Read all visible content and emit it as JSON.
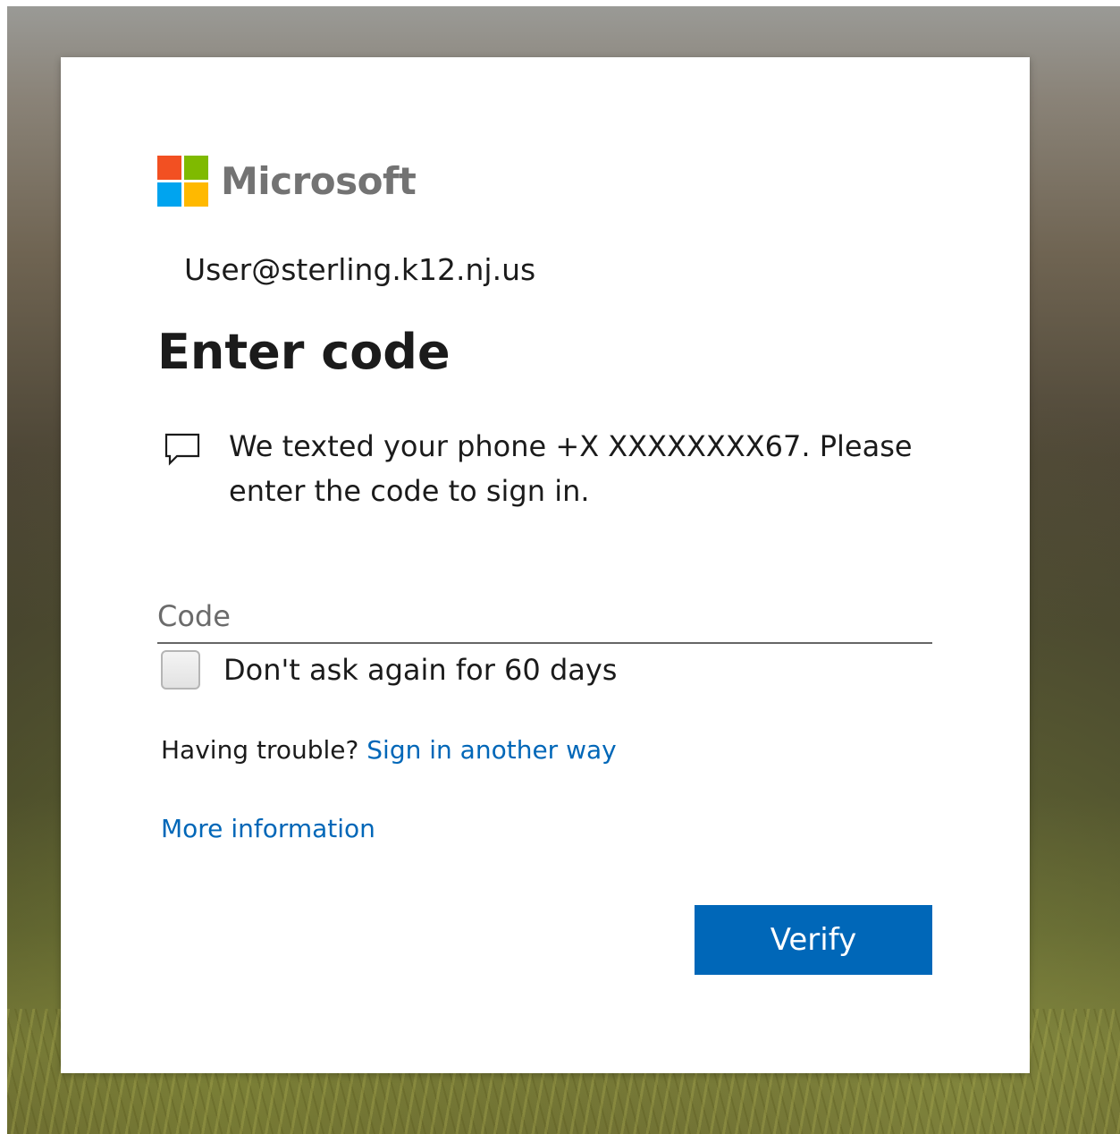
{
  "brand": {
    "name": "Microsoft",
    "logo_colors": [
      "#f25022",
      "#7fba00",
      "#00a4ef",
      "#ffb900"
    ],
    "word_color": "#737373"
  },
  "identity": {
    "email": "User@sterling.k12.nj.us"
  },
  "page": {
    "title": "Enter code"
  },
  "message": {
    "icon": "chat-bubble-icon",
    "text": "We texted your phone +X XXXXXXXX67. Please enter the code to sign in."
  },
  "code_field": {
    "placeholder": "Code",
    "value": ""
  },
  "remember": {
    "label": "Don't ask again for 60 days",
    "checked": false
  },
  "trouble": {
    "prefix": "Having trouble? ",
    "link_label": "Sign in another way"
  },
  "more_info": {
    "label": "More information"
  },
  "actions": {
    "verify_label": "Verify"
  },
  "colors": {
    "accent": "#0067b8",
    "text": "#1b1b1b"
  }
}
